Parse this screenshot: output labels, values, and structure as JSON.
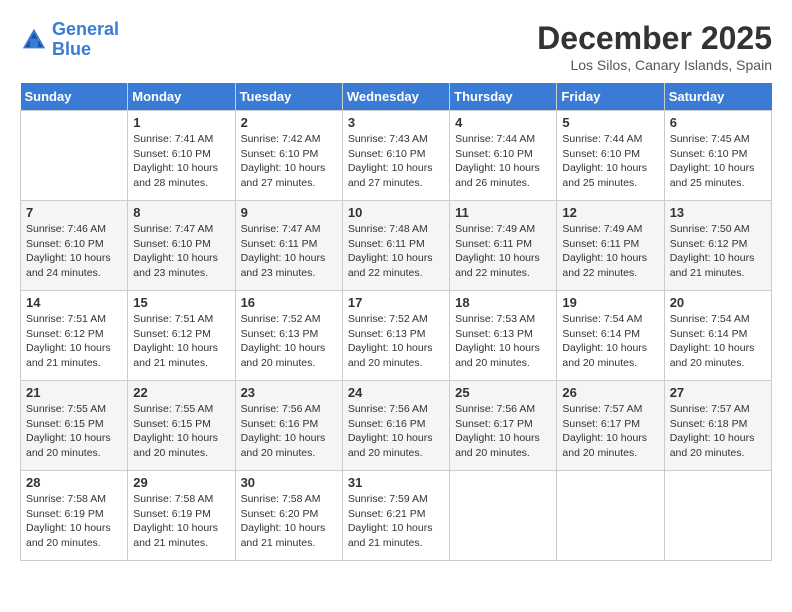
{
  "header": {
    "logo_line1": "General",
    "logo_line2": "Blue",
    "month": "December 2025",
    "location": "Los Silos, Canary Islands, Spain"
  },
  "weekdays": [
    "Sunday",
    "Monday",
    "Tuesday",
    "Wednesday",
    "Thursday",
    "Friday",
    "Saturday"
  ],
  "weeks": [
    [
      {
        "day": "",
        "sunrise": "",
        "sunset": "",
        "daylight": ""
      },
      {
        "day": "1",
        "sunrise": "Sunrise: 7:41 AM",
        "sunset": "Sunset: 6:10 PM",
        "daylight": "Daylight: 10 hours and 28 minutes."
      },
      {
        "day": "2",
        "sunrise": "Sunrise: 7:42 AM",
        "sunset": "Sunset: 6:10 PM",
        "daylight": "Daylight: 10 hours and 27 minutes."
      },
      {
        "day": "3",
        "sunrise": "Sunrise: 7:43 AM",
        "sunset": "Sunset: 6:10 PM",
        "daylight": "Daylight: 10 hours and 27 minutes."
      },
      {
        "day": "4",
        "sunrise": "Sunrise: 7:44 AM",
        "sunset": "Sunset: 6:10 PM",
        "daylight": "Daylight: 10 hours and 26 minutes."
      },
      {
        "day": "5",
        "sunrise": "Sunrise: 7:44 AM",
        "sunset": "Sunset: 6:10 PM",
        "daylight": "Daylight: 10 hours and 25 minutes."
      },
      {
        "day": "6",
        "sunrise": "Sunrise: 7:45 AM",
        "sunset": "Sunset: 6:10 PM",
        "daylight": "Daylight: 10 hours and 25 minutes."
      }
    ],
    [
      {
        "day": "7",
        "sunrise": "Sunrise: 7:46 AM",
        "sunset": "Sunset: 6:10 PM",
        "daylight": "Daylight: 10 hours and 24 minutes."
      },
      {
        "day": "8",
        "sunrise": "Sunrise: 7:47 AM",
        "sunset": "Sunset: 6:10 PM",
        "daylight": "Daylight: 10 hours and 23 minutes."
      },
      {
        "day": "9",
        "sunrise": "Sunrise: 7:47 AM",
        "sunset": "Sunset: 6:11 PM",
        "daylight": "Daylight: 10 hours and 23 minutes."
      },
      {
        "day": "10",
        "sunrise": "Sunrise: 7:48 AM",
        "sunset": "Sunset: 6:11 PM",
        "daylight": "Daylight: 10 hours and 22 minutes."
      },
      {
        "day": "11",
        "sunrise": "Sunrise: 7:49 AM",
        "sunset": "Sunset: 6:11 PM",
        "daylight": "Daylight: 10 hours and 22 minutes."
      },
      {
        "day": "12",
        "sunrise": "Sunrise: 7:49 AM",
        "sunset": "Sunset: 6:11 PM",
        "daylight": "Daylight: 10 hours and 22 minutes."
      },
      {
        "day": "13",
        "sunrise": "Sunrise: 7:50 AM",
        "sunset": "Sunset: 6:12 PM",
        "daylight": "Daylight: 10 hours and 21 minutes."
      }
    ],
    [
      {
        "day": "14",
        "sunrise": "Sunrise: 7:51 AM",
        "sunset": "Sunset: 6:12 PM",
        "daylight": "Daylight: 10 hours and 21 minutes."
      },
      {
        "day": "15",
        "sunrise": "Sunrise: 7:51 AM",
        "sunset": "Sunset: 6:12 PM",
        "daylight": "Daylight: 10 hours and 21 minutes."
      },
      {
        "day": "16",
        "sunrise": "Sunrise: 7:52 AM",
        "sunset": "Sunset: 6:13 PM",
        "daylight": "Daylight: 10 hours and 20 minutes."
      },
      {
        "day": "17",
        "sunrise": "Sunrise: 7:52 AM",
        "sunset": "Sunset: 6:13 PM",
        "daylight": "Daylight: 10 hours and 20 minutes."
      },
      {
        "day": "18",
        "sunrise": "Sunrise: 7:53 AM",
        "sunset": "Sunset: 6:13 PM",
        "daylight": "Daylight: 10 hours and 20 minutes."
      },
      {
        "day": "19",
        "sunrise": "Sunrise: 7:54 AM",
        "sunset": "Sunset: 6:14 PM",
        "daylight": "Daylight: 10 hours and 20 minutes."
      },
      {
        "day": "20",
        "sunrise": "Sunrise: 7:54 AM",
        "sunset": "Sunset: 6:14 PM",
        "daylight": "Daylight: 10 hours and 20 minutes."
      }
    ],
    [
      {
        "day": "21",
        "sunrise": "Sunrise: 7:55 AM",
        "sunset": "Sunset: 6:15 PM",
        "daylight": "Daylight: 10 hours and 20 minutes."
      },
      {
        "day": "22",
        "sunrise": "Sunrise: 7:55 AM",
        "sunset": "Sunset: 6:15 PM",
        "daylight": "Daylight: 10 hours and 20 minutes."
      },
      {
        "day": "23",
        "sunrise": "Sunrise: 7:56 AM",
        "sunset": "Sunset: 6:16 PM",
        "daylight": "Daylight: 10 hours and 20 minutes."
      },
      {
        "day": "24",
        "sunrise": "Sunrise: 7:56 AM",
        "sunset": "Sunset: 6:16 PM",
        "daylight": "Daylight: 10 hours and 20 minutes."
      },
      {
        "day": "25",
        "sunrise": "Sunrise: 7:56 AM",
        "sunset": "Sunset: 6:17 PM",
        "daylight": "Daylight: 10 hours and 20 minutes."
      },
      {
        "day": "26",
        "sunrise": "Sunrise: 7:57 AM",
        "sunset": "Sunset: 6:17 PM",
        "daylight": "Daylight: 10 hours and 20 minutes."
      },
      {
        "day": "27",
        "sunrise": "Sunrise: 7:57 AM",
        "sunset": "Sunset: 6:18 PM",
        "daylight": "Daylight: 10 hours and 20 minutes."
      }
    ],
    [
      {
        "day": "28",
        "sunrise": "Sunrise: 7:58 AM",
        "sunset": "Sunset: 6:19 PM",
        "daylight": "Daylight: 10 hours and 20 minutes."
      },
      {
        "day": "29",
        "sunrise": "Sunrise: 7:58 AM",
        "sunset": "Sunset: 6:19 PM",
        "daylight": "Daylight: 10 hours and 21 minutes."
      },
      {
        "day": "30",
        "sunrise": "Sunrise: 7:58 AM",
        "sunset": "Sunset: 6:20 PM",
        "daylight": "Daylight: 10 hours and 21 minutes."
      },
      {
        "day": "31",
        "sunrise": "Sunrise: 7:59 AM",
        "sunset": "Sunset: 6:21 PM",
        "daylight": "Daylight: 10 hours and 21 minutes."
      },
      {
        "day": "",
        "sunrise": "",
        "sunset": "",
        "daylight": ""
      },
      {
        "day": "",
        "sunrise": "",
        "sunset": "",
        "daylight": ""
      },
      {
        "day": "",
        "sunrise": "",
        "sunset": "",
        "daylight": ""
      }
    ]
  ]
}
